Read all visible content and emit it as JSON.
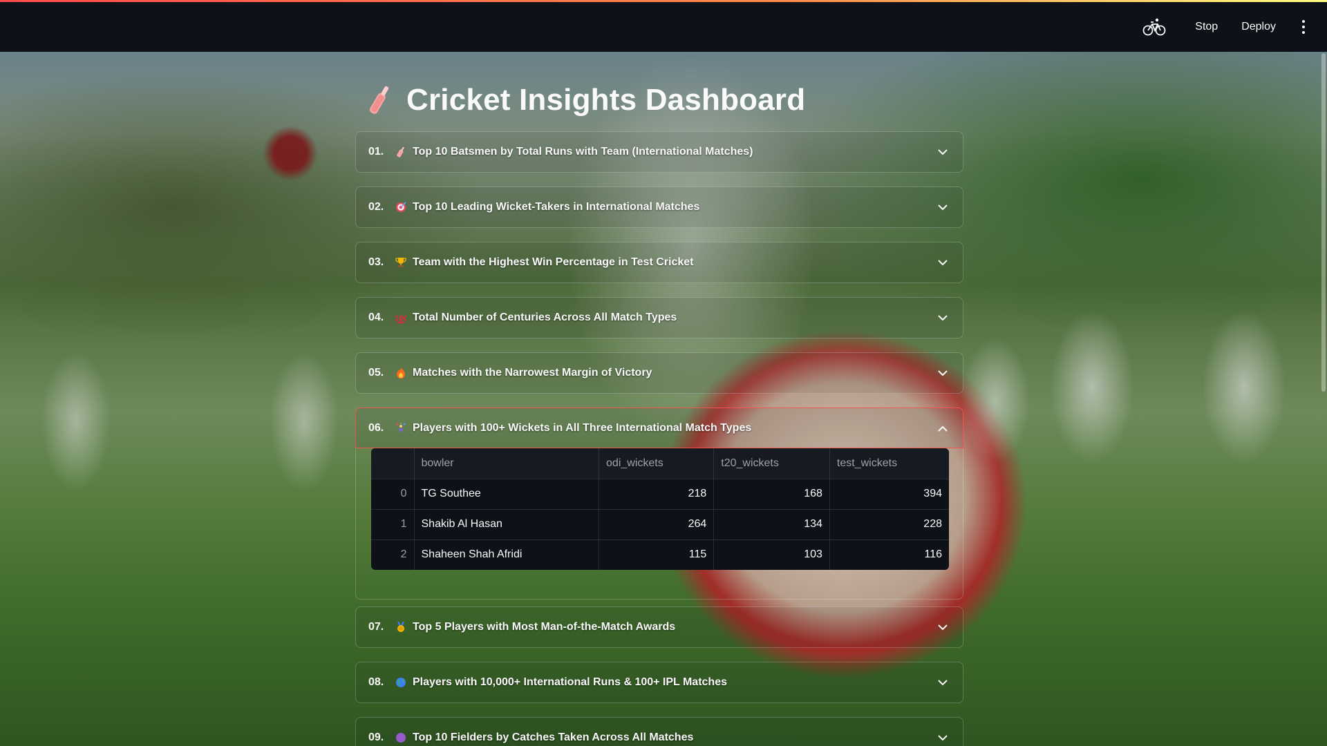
{
  "header": {
    "stop_label": "Stop",
    "deploy_label": "Deploy",
    "status_icon": "bicycle-icon",
    "menu_icon": "vertical-dots-icon"
  },
  "page": {
    "title": "Cricket Insights Dashboard",
    "title_icon": "cricket-bat-icon"
  },
  "expanders": [
    {
      "num": "01.",
      "icon": "cricket-bat-icon",
      "title": "Top 10 Batsmen by Total Runs with Team (International Matches)",
      "expanded": false
    },
    {
      "num": "02.",
      "icon": "target-icon",
      "title": "Top 10 Leading Wicket-Takers in International Matches",
      "expanded": false
    },
    {
      "num": "03.",
      "icon": "trophy-icon",
      "title": "Team with the Highest Win Percentage in Test Cricket",
      "expanded": false
    },
    {
      "num": "04.",
      "icon": "hundred-points-icon",
      "title": "Total Number of Centuries Across All Match Types",
      "expanded": false
    },
    {
      "num": "05.",
      "icon": "fire-icon",
      "title": "Matches with the Narrowest Margin of Victory",
      "expanded": false
    },
    {
      "num": "06.",
      "icon": "juggling-person-icon",
      "title": "Players with 100+ Wickets in All Three International Match Types",
      "expanded": true
    },
    {
      "num": "07.",
      "icon": "medal-icon",
      "title": "Top 5 Players with Most Man-of-the-Match Awards",
      "expanded": false
    },
    {
      "num": "08.",
      "icon": "globe-icon",
      "title": "Players with 10,000+ International Runs & 100+ IPL Matches",
      "expanded": false
    },
    {
      "num": "09.",
      "icon": "purple-circle-icon",
      "title": "Top 10 Fielders by Catches Taken Across All Matches",
      "expanded": false
    }
  ],
  "table": {
    "columns": [
      "bowler",
      "odi_wickets",
      "t20_wickets",
      "test_wickets"
    ],
    "rows": [
      {
        "index": "0",
        "bowler": "TG Southee",
        "odi_wickets": "218",
        "t20_wickets": "168",
        "test_wickets": "394"
      },
      {
        "index": "1",
        "bowler": "Shakib Al Hasan",
        "odi_wickets": "264",
        "t20_wickets": "134",
        "test_wickets": "228"
      },
      {
        "index": "2",
        "bowler": "Shaheen Shah Afridi",
        "odi_wickets": "115",
        "t20_wickets": "103",
        "test_wickets": "116"
      }
    ]
  },
  "colors": {
    "accent": "#ff4b4b",
    "topbar_bg": "#0e1117",
    "text": "#fafafa"
  }
}
